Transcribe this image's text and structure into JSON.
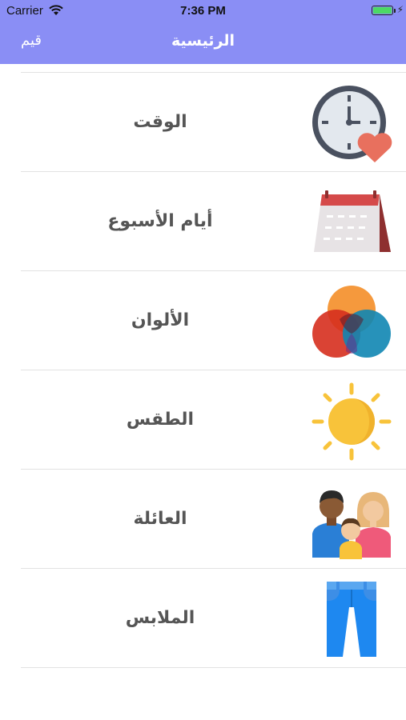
{
  "status_bar": {
    "carrier": "Carrier",
    "time": "7:36 PM"
  },
  "nav": {
    "title": "الرئيسية",
    "left_button": "قيم"
  },
  "categories": [
    {
      "label": "الوقت",
      "icon": "clock-icon"
    },
    {
      "label": "أيام الأسبوع",
      "icon": "calendar-icon"
    },
    {
      "label": "الألوان",
      "icon": "color-circles-icon"
    },
    {
      "label": "الطقس",
      "icon": "sun-icon"
    },
    {
      "label": "العائلة",
      "icon": "family-icon"
    },
    {
      "label": "الملابس",
      "icon": "jeans-icon"
    }
  ],
  "colors": {
    "nav_background": "#8a8ef5",
    "label_text": "#555555",
    "separator": "#e2e2e2"
  }
}
